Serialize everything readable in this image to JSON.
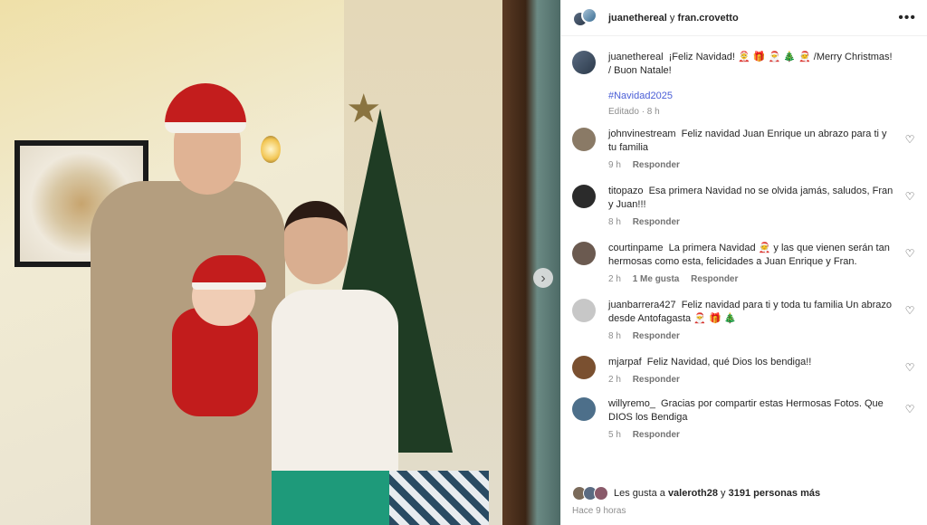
{
  "post_header": {
    "user1": "juanethereal",
    "connector": "y",
    "user2": "fran.crovetto",
    "more_icon": "more-icon"
  },
  "caption": {
    "user": "juanethereal",
    "text": "¡Feliz Navidad! 🤶 🎁 🎅 🎄 🧑‍🎄 /Merry Christmas! / Buon Natale!",
    "hashtag": "#Navidad2025",
    "meta": "Editado · 8 h"
  },
  "comments": [
    {
      "user": "johnvinestream",
      "text": "Feliz navidad Juan Enrique un abrazo para ti y tu familia",
      "time": "9 h",
      "likes": "",
      "reply": "Responder",
      "avatar_color": "#8a7a66"
    },
    {
      "user": "titopazo",
      "text": "Esa primera Navidad no se olvida jamás, saludos, Fran y Juan!!!",
      "time": "8 h",
      "likes": "",
      "reply": "Responder",
      "avatar_color": "#2b2b2b"
    },
    {
      "user": "courtinpame",
      "text": "La primera Navidad 🧑‍🎄 y las que vienen serán tan hermosas como esta, felicidades a Juan Enrique y Fran.",
      "time": "2 h",
      "likes": "1 Me gusta",
      "reply": "Responder",
      "avatar_color": "#6b5a50"
    },
    {
      "user": "juanbarrera427",
      "text": "Feliz navidad para ti y toda tu familia Un abrazo desde Antofagasta 🎅 🎁 🎄",
      "time": "8 h",
      "likes": "",
      "reply": "Responder",
      "avatar_color": "#c7c7c7"
    },
    {
      "user": "mjarpaf",
      "text": "Feliz Navidad, qué Dios los bendiga!!",
      "time": "2 h",
      "likes": "",
      "reply": "Responder",
      "avatar_color": "#7a5030"
    },
    {
      "user": "willyremo_",
      "text": "Gracias por compartir estas Hermosas Fotos. Que DIOS los Bendiga",
      "time": "5 h",
      "likes": "",
      "reply": "Responder",
      "avatar_color": "#4d6f8a"
    }
  ],
  "footer": {
    "likes_prefix": "Les gusta a",
    "liker": "valeroth28",
    "likes_connector": "y",
    "likes_count": "3191 personas más",
    "timestamp": "Hace 9 horas"
  },
  "icons": {
    "heart": "heart-icon",
    "next": "chevron-right-icon"
  },
  "colors": {
    "link": "#4a5ed6",
    "muted": "#8e8e8e",
    "text": "#262626"
  }
}
